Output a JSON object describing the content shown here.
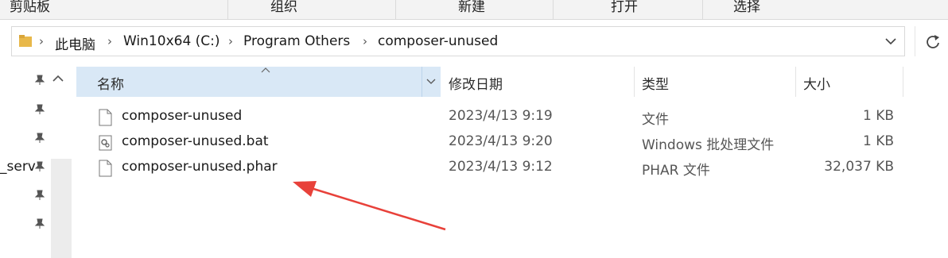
{
  "ribbon": {
    "clipboard": "剪贴板",
    "organize": "组织",
    "new": "新建",
    "open": "打开",
    "select": "选择"
  },
  "address": {
    "crumbs": [
      "此电脑",
      "Win10x64 (C:)",
      "Program Others",
      "composer-unused"
    ]
  },
  "nav": {
    "partial_label": "_serv"
  },
  "columns": {
    "name": "名称",
    "modified": "修改日期",
    "type": "类型",
    "size": "大小"
  },
  "files": [
    {
      "name": "composer-unused",
      "modified": "2023/4/13 9:19",
      "type": "文件",
      "size": "1 KB",
      "icon": "blank-file-icon"
    },
    {
      "name": "composer-unused.bat",
      "modified": "2023/4/13 9:20",
      "type": "Windows 批处理文件",
      "size": "1 KB",
      "icon": "batch-file-icon"
    },
    {
      "name": "composer-unused.phar",
      "modified": "2023/4/13 9:12",
      "type": "PHAR 文件",
      "size": "32,037 KB",
      "icon": "blank-file-icon"
    }
  ],
  "colors": {
    "header_selected": "#d9e8f6",
    "annotation_arrow": "#e8413a"
  }
}
